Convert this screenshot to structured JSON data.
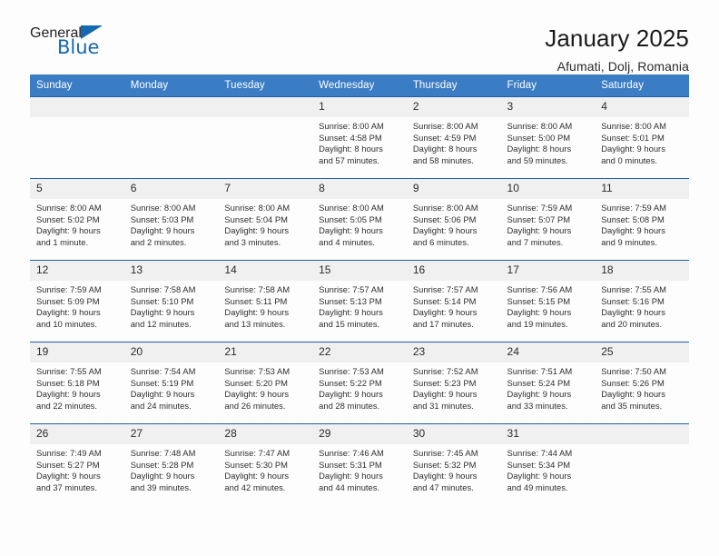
{
  "brand": {
    "name_top": "General",
    "name_bottom": "Blue",
    "accent_color": "#1569b0"
  },
  "header": {
    "title": "January 2025",
    "subtitle": "Afumati, Dolj, Romania"
  },
  "calendar": {
    "header_bg": "#3b7dc4",
    "header_text_color": "#ffffff",
    "daynum_bg": "#f0f0f0",
    "cell_border_color": "#1f5fa8",
    "weekdays": [
      "Sunday",
      "Monday",
      "Tuesday",
      "Wednesday",
      "Thursday",
      "Friday",
      "Saturday"
    ],
    "labels": {
      "sunrise": "Sunrise:",
      "sunset": "Sunset:",
      "daylight": "Daylight:"
    },
    "weeks": [
      [
        {
          "day": "",
          "sunrise": "",
          "sunset": "",
          "daylight": "",
          "daylight2": ""
        },
        {
          "day": "",
          "sunrise": "",
          "sunset": "",
          "daylight": "",
          "daylight2": ""
        },
        {
          "day": "",
          "sunrise": "",
          "sunset": "",
          "daylight": "",
          "daylight2": ""
        },
        {
          "day": "1",
          "sunrise": "Sunrise: 8:00 AM",
          "sunset": "Sunset: 4:58 PM",
          "daylight": "Daylight: 8 hours",
          "daylight2": "and 57 minutes."
        },
        {
          "day": "2",
          "sunrise": "Sunrise: 8:00 AM",
          "sunset": "Sunset: 4:59 PM",
          "daylight": "Daylight: 8 hours",
          "daylight2": "and 58 minutes."
        },
        {
          "day": "3",
          "sunrise": "Sunrise: 8:00 AM",
          "sunset": "Sunset: 5:00 PM",
          "daylight": "Daylight: 8 hours",
          "daylight2": "and 59 minutes."
        },
        {
          "day": "4",
          "sunrise": "Sunrise: 8:00 AM",
          "sunset": "Sunset: 5:01 PM",
          "daylight": "Daylight: 9 hours",
          "daylight2": "and 0 minutes."
        }
      ],
      [
        {
          "day": "5",
          "sunrise": "Sunrise: 8:00 AM",
          "sunset": "Sunset: 5:02 PM",
          "daylight": "Daylight: 9 hours",
          "daylight2": "and 1 minute."
        },
        {
          "day": "6",
          "sunrise": "Sunrise: 8:00 AM",
          "sunset": "Sunset: 5:03 PM",
          "daylight": "Daylight: 9 hours",
          "daylight2": "and 2 minutes."
        },
        {
          "day": "7",
          "sunrise": "Sunrise: 8:00 AM",
          "sunset": "Sunset: 5:04 PM",
          "daylight": "Daylight: 9 hours",
          "daylight2": "and 3 minutes."
        },
        {
          "day": "8",
          "sunrise": "Sunrise: 8:00 AM",
          "sunset": "Sunset: 5:05 PM",
          "daylight": "Daylight: 9 hours",
          "daylight2": "and 4 minutes."
        },
        {
          "day": "9",
          "sunrise": "Sunrise: 8:00 AM",
          "sunset": "Sunset: 5:06 PM",
          "daylight": "Daylight: 9 hours",
          "daylight2": "and 6 minutes."
        },
        {
          "day": "10",
          "sunrise": "Sunrise: 7:59 AM",
          "sunset": "Sunset: 5:07 PM",
          "daylight": "Daylight: 9 hours",
          "daylight2": "and 7 minutes."
        },
        {
          "day": "11",
          "sunrise": "Sunrise: 7:59 AM",
          "sunset": "Sunset: 5:08 PM",
          "daylight": "Daylight: 9 hours",
          "daylight2": "and 9 minutes."
        }
      ],
      [
        {
          "day": "12",
          "sunrise": "Sunrise: 7:59 AM",
          "sunset": "Sunset: 5:09 PM",
          "daylight": "Daylight: 9 hours",
          "daylight2": "and 10 minutes."
        },
        {
          "day": "13",
          "sunrise": "Sunrise: 7:58 AM",
          "sunset": "Sunset: 5:10 PM",
          "daylight": "Daylight: 9 hours",
          "daylight2": "and 12 minutes."
        },
        {
          "day": "14",
          "sunrise": "Sunrise: 7:58 AM",
          "sunset": "Sunset: 5:11 PM",
          "daylight": "Daylight: 9 hours",
          "daylight2": "and 13 minutes."
        },
        {
          "day": "15",
          "sunrise": "Sunrise: 7:57 AM",
          "sunset": "Sunset: 5:13 PM",
          "daylight": "Daylight: 9 hours",
          "daylight2": "and 15 minutes."
        },
        {
          "day": "16",
          "sunrise": "Sunrise: 7:57 AM",
          "sunset": "Sunset: 5:14 PM",
          "daylight": "Daylight: 9 hours",
          "daylight2": "and 17 minutes."
        },
        {
          "day": "17",
          "sunrise": "Sunrise: 7:56 AM",
          "sunset": "Sunset: 5:15 PM",
          "daylight": "Daylight: 9 hours",
          "daylight2": "and 19 minutes."
        },
        {
          "day": "18",
          "sunrise": "Sunrise: 7:55 AM",
          "sunset": "Sunset: 5:16 PM",
          "daylight": "Daylight: 9 hours",
          "daylight2": "and 20 minutes."
        }
      ],
      [
        {
          "day": "19",
          "sunrise": "Sunrise: 7:55 AM",
          "sunset": "Sunset: 5:18 PM",
          "daylight": "Daylight: 9 hours",
          "daylight2": "and 22 minutes."
        },
        {
          "day": "20",
          "sunrise": "Sunrise: 7:54 AM",
          "sunset": "Sunset: 5:19 PM",
          "daylight": "Daylight: 9 hours",
          "daylight2": "and 24 minutes."
        },
        {
          "day": "21",
          "sunrise": "Sunrise: 7:53 AM",
          "sunset": "Sunset: 5:20 PM",
          "daylight": "Daylight: 9 hours",
          "daylight2": "and 26 minutes."
        },
        {
          "day": "22",
          "sunrise": "Sunrise: 7:53 AM",
          "sunset": "Sunset: 5:22 PM",
          "daylight": "Daylight: 9 hours",
          "daylight2": "and 28 minutes."
        },
        {
          "day": "23",
          "sunrise": "Sunrise: 7:52 AM",
          "sunset": "Sunset: 5:23 PM",
          "daylight": "Daylight: 9 hours",
          "daylight2": "and 31 minutes."
        },
        {
          "day": "24",
          "sunrise": "Sunrise: 7:51 AM",
          "sunset": "Sunset: 5:24 PM",
          "daylight": "Daylight: 9 hours",
          "daylight2": "and 33 minutes."
        },
        {
          "day": "25",
          "sunrise": "Sunrise: 7:50 AM",
          "sunset": "Sunset: 5:26 PM",
          "daylight": "Daylight: 9 hours",
          "daylight2": "and 35 minutes."
        }
      ],
      [
        {
          "day": "26",
          "sunrise": "Sunrise: 7:49 AM",
          "sunset": "Sunset: 5:27 PM",
          "daylight": "Daylight: 9 hours",
          "daylight2": "and 37 minutes."
        },
        {
          "day": "27",
          "sunrise": "Sunrise: 7:48 AM",
          "sunset": "Sunset: 5:28 PM",
          "daylight": "Daylight: 9 hours",
          "daylight2": "and 39 minutes."
        },
        {
          "day": "28",
          "sunrise": "Sunrise: 7:47 AM",
          "sunset": "Sunset: 5:30 PM",
          "daylight": "Daylight: 9 hours",
          "daylight2": "and 42 minutes."
        },
        {
          "day": "29",
          "sunrise": "Sunrise: 7:46 AM",
          "sunset": "Sunset: 5:31 PM",
          "daylight": "Daylight: 9 hours",
          "daylight2": "and 44 minutes."
        },
        {
          "day": "30",
          "sunrise": "Sunrise: 7:45 AM",
          "sunset": "Sunset: 5:32 PM",
          "daylight": "Daylight: 9 hours",
          "daylight2": "and 47 minutes."
        },
        {
          "day": "31",
          "sunrise": "Sunrise: 7:44 AM",
          "sunset": "Sunset: 5:34 PM",
          "daylight": "Daylight: 9 hours",
          "daylight2": "and 49 minutes."
        },
        {
          "day": "",
          "sunrise": "",
          "sunset": "",
          "daylight": "",
          "daylight2": ""
        }
      ]
    ]
  }
}
